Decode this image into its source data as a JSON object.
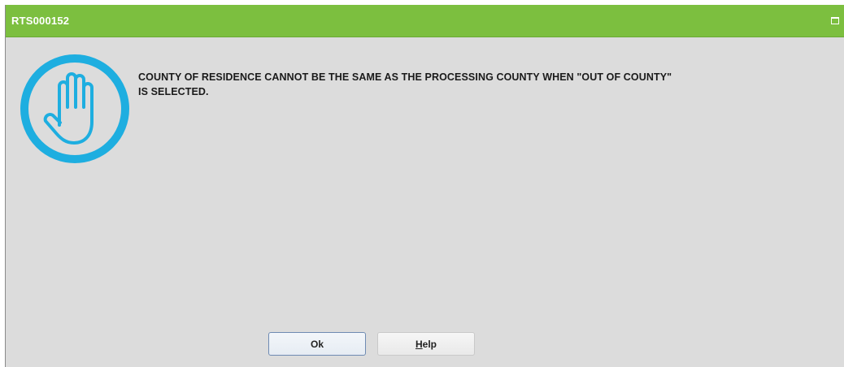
{
  "window": {
    "title": "RTS000152",
    "colors": {
      "titlebar": "#7cbf3f",
      "body": "#dcdcdc",
      "icon": "#1eaee0"
    }
  },
  "icon": {
    "name": "stop-hand-icon"
  },
  "message": {
    "line1": "COUNTY OF RESIDENCE CANNOT BE THE SAME AS THE PROCESSING COUNTY WHEN \"OUT OF COUNTY\"",
    "line2": "IS SELECTED."
  },
  "buttons": {
    "ok_label": "Ok",
    "help_mnemonic": "H",
    "help_rest": "elp"
  }
}
